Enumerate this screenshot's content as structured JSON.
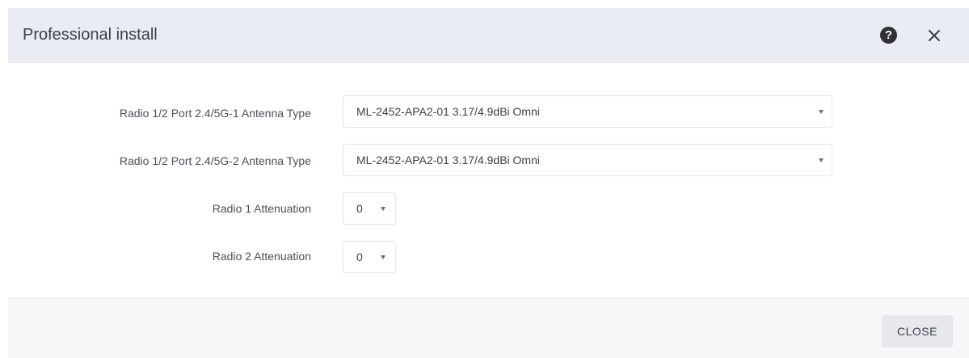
{
  "dialog": {
    "title": "Professional install",
    "help_icon": "question-circle-icon",
    "close_icon": "close-x-icon"
  },
  "form": {
    "rows": [
      {
        "label": "Radio 1/2 Port 2.4/5G-1 Antenna Type",
        "value": "ML-2452-APA2-01 3.17/4.9dBi Omni"
      },
      {
        "label": "Radio 1/2 Port 2.4/5G-2 Antenna Type",
        "value": "ML-2452-APA2-01 3.17/4.9dBi Omni"
      },
      {
        "label": "Radio 1 Attenuation",
        "value": "0"
      },
      {
        "label": "Radio 2 Attenuation",
        "value": "0"
      }
    ]
  },
  "footer": {
    "close_label": "CLOSE"
  },
  "colors": {
    "header_bg": "#e9ecf3",
    "footer_bg": "#f6f7f9",
    "text": "#3a3f4a",
    "button_bg": "#e6e8ec"
  }
}
